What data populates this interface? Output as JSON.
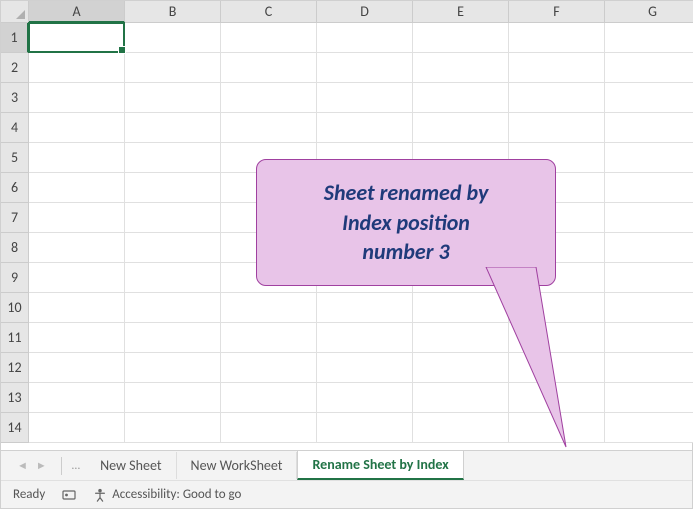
{
  "grid": {
    "columns": [
      "A",
      "B",
      "C",
      "D",
      "E",
      "F",
      "G"
    ],
    "rows": [
      "1",
      "2",
      "3",
      "4",
      "5",
      "6",
      "7",
      "8",
      "9",
      "10",
      "11",
      "12",
      "13",
      "14"
    ],
    "active_cell": "A1"
  },
  "callout": {
    "line1": "Sheet renamed by",
    "line2": "Index position",
    "line3": "number 3"
  },
  "tabs": {
    "items": [
      {
        "label": "New Sheet",
        "active": false
      },
      {
        "label": "New WorkSheet",
        "active": false
      },
      {
        "label": "Rename Sheet by Index",
        "active": true
      }
    ]
  },
  "status": {
    "ready": "Ready",
    "accessibility": "Accessibility: Good to go"
  }
}
